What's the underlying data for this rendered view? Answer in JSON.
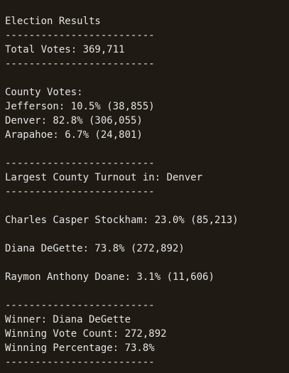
{
  "title": "Election Results",
  "divider": "-------------------------",
  "total_votes": "Total Votes: 369,711",
  "county_header": "County Votes:",
  "counties": [
    "Jefferson: 10.5% (38,855)",
    "Denver: 82.8% (306,055)",
    "Arapahoe: 6.7% (24,801)"
  ],
  "largest_turnout": "Largest County Turnout in: Denver",
  "candidates": [
    "Charles Casper Stockham: 23.0% (85,213)",
    "Diana DeGette: 73.8% (272,892)",
    "Raymon Anthony Doane: 3.1% (11,606)"
  ],
  "winner": "Winner: Diana DeGette",
  "winning_vote_count": "Winning Vote Count: 272,892",
  "winning_percentage": "Winning Percentage: 73.8%"
}
